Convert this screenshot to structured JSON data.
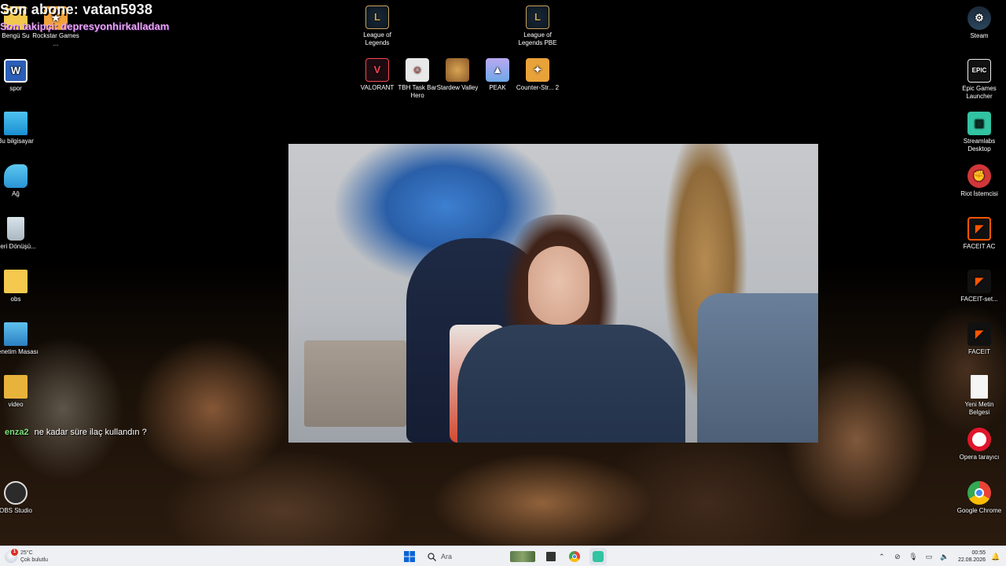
{
  "overlay": {
    "last_subscriber": "Son abone: vatan5938",
    "last_follower": "Son takipçi: depresyonhirkalladam"
  },
  "chat": {
    "user": "enza2",
    "message": "ne kadar süre ilaç kullandın ?"
  },
  "desktop_left": [
    {
      "label": "Bengü Su",
      "icon": "folder-icon"
    },
    {
      "label": "spor",
      "icon": "word-document-icon"
    },
    {
      "label": "Bu bilgisayar",
      "icon": "computer-icon"
    },
    {
      "label": "Ağ",
      "icon": "network-icon"
    },
    {
      "label": "Geri Dönüşü...",
      "icon": "recycle-bin-icon"
    },
    {
      "label": "obs",
      "icon": "folder-icon"
    },
    {
      "label": "Denetim Masası",
      "icon": "control-panel-icon"
    },
    {
      "label": "video",
      "icon": "folder-icon"
    },
    {
      "label": "OBS Studio",
      "icon": "obs-icon"
    }
  ],
  "desktop_left2": [
    {
      "label": "Rockstar Games ...",
      "icon": "rockstar-icon"
    }
  ],
  "desktop_top": [
    {
      "label": "League of Legends",
      "icon": "league-icon"
    },
    {
      "label": "League of Legends PBE",
      "icon": "league-pbe-icon"
    },
    {
      "label": "VALORANT",
      "icon": "valorant-icon"
    },
    {
      "label": "TBH Task Bar Hero",
      "icon": "tbh-icon"
    },
    {
      "label": "Stardew Valley",
      "icon": "stardew-icon"
    },
    {
      "label": "PEAK",
      "icon": "peak-icon"
    },
    {
      "label": "Counter-Str... 2",
      "icon": "counter-strike-icon"
    }
  ],
  "desktop_right": [
    {
      "label": "Steam",
      "icon": "steam-icon"
    },
    {
      "label": "Epic Games Launcher",
      "icon": "epic-games-icon"
    },
    {
      "label": "Streamlabs Desktop",
      "icon": "streamlabs-icon"
    },
    {
      "label": "Riot İstemcisi",
      "icon": "riot-client-icon"
    },
    {
      "label": "FACEIT AC",
      "icon": "faceit-ac-icon"
    },
    {
      "label": "FACEIT-set...",
      "icon": "faceit-setup-icon"
    },
    {
      "label": "FACEIT",
      "icon": "faceit-icon"
    },
    {
      "label": "Yeni Metin Belgesi",
      "icon": "text-document-icon"
    },
    {
      "label": "Opera tarayıcı",
      "icon": "opera-icon"
    },
    {
      "label": "Google Chrome",
      "icon": "chrome-icon"
    }
  ],
  "taskbar": {
    "weather_temp": "25°C",
    "weather_desc": "Çok bulutlu",
    "weather_badge": "1",
    "search_placeholder": "Ara",
    "time": "00:55",
    "date": "22.08.2026"
  },
  "colors": {
    "taskbar_bg": "#eef0f4",
    "overlay_follower": "#e7a6f2",
    "chat_user": "#7be07b",
    "windows_blue": "#0a64d8"
  }
}
